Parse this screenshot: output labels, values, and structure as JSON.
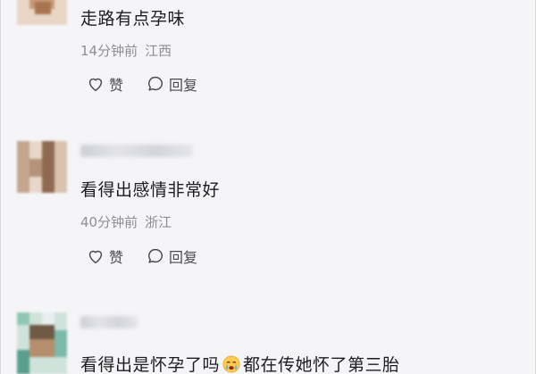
{
  "comments": [
    {
      "content": "走路有点孕味",
      "time": "14分钟前",
      "location": "江西",
      "like_label": "赞",
      "reply_label": "回复"
    },
    {
      "content": "看得出感情非常好",
      "time": "40分钟前",
      "location": "浙江",
      "like_label": "赞",
      "reply_label": "回复"
    },
    {
      "content_before": "看得出是怀孕了吗",
      "emoji": "crying-face-emoji",
      "content_after": "都在传她怀了第三胎"
    }
  ],
  "icons": {
    "like": "heart-outline-icon",
    "reply": "speech-bubble-icon"
  },
  "colors": {
    "background": "#f5f5f7",
    "text_primary": "#1d1d1f",
    "text_meta": "#8e8e93"
  }
}
